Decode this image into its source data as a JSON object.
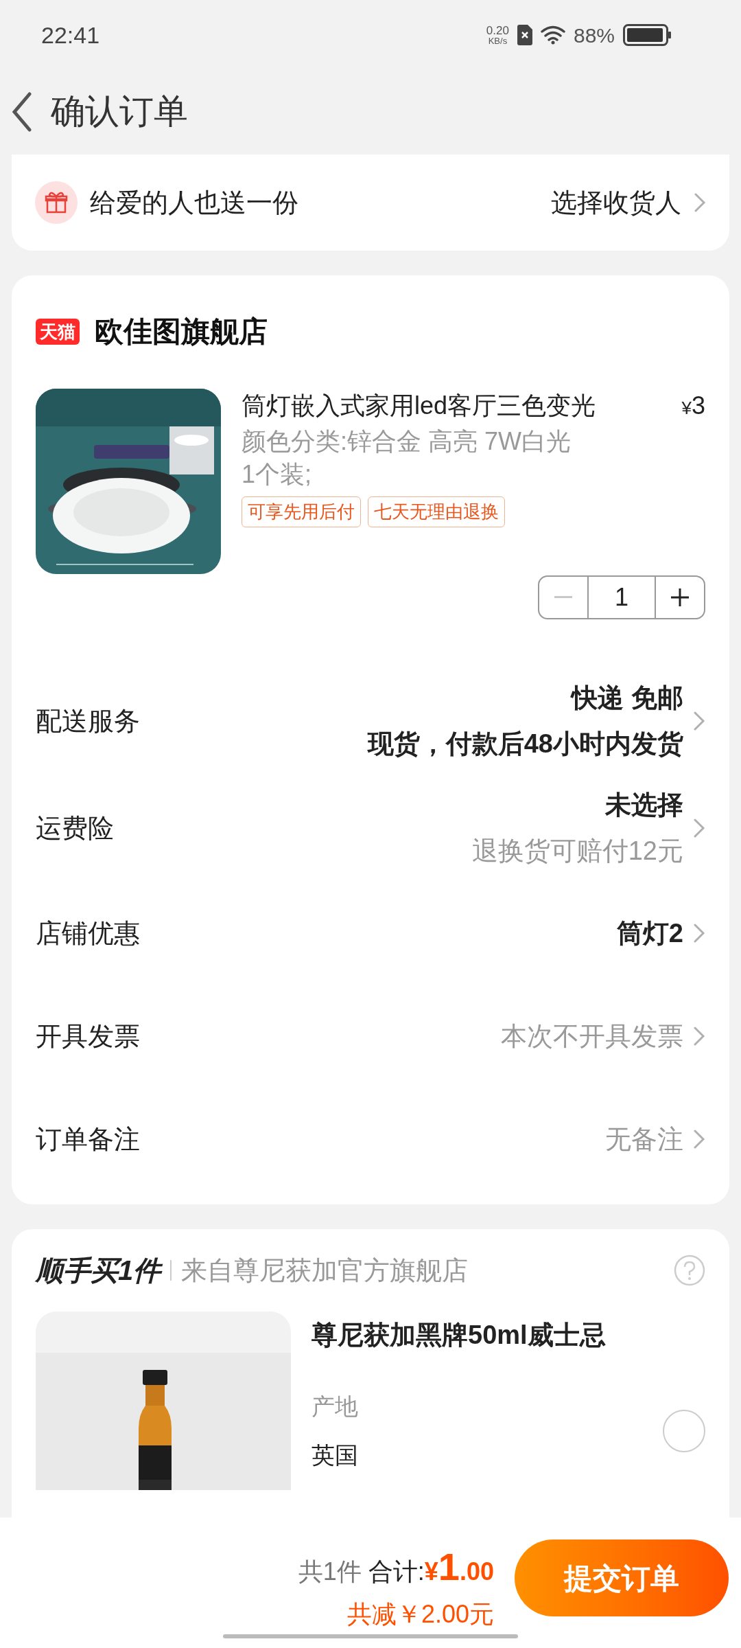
{
  "status_bar": {
    "time": "22:41",
    "net_speed_value": "0.20",
    "net_speed_unit": "KB/s",
    "battery": "88%"
  },
  "header": {
    "title": "确认订单"
  },
  "gift_row": {
    "label": "给爱的人也送一份",
    "action": "选择收货人"
  },
  "store": {
    "badge": "天猫",
    "name": "欧佳图旗舰店"
  },
  "product": {
    "title": "筒灯嵌入式家用led客厅三色变光",
    "currency": "¥",
    "price": "3",
    "specs": [
      "颜色分类:锌合金 高亮 7W白光",
      "1个装;"
    ],
    "tags": [
      "可享先用后付",
      "七天无理由退换"
    ],
    "quantity": "1",
    "minus_disabled": true
  },
  "rows": [
    {
      "label": "配送服务",
      "values": [
        {
          "text": "快递 免邮",
          "kind": "strong"
        },
        {
          "text": "现货，付款后48小时内发货",
          "kind": "strong"
        }
      ]
    },
    {
      "label": "运费险",
      "values": [
        {
          "text": "未选择",
          "kind": "strong"
        },
        {
          "text": "退换货可赔付12元",
          "kind": "muted"
        }
      ]
    },
    {
      "label": "店铺优惠",
      "values": [
        {
          "text": "筒灯2",
          "kind": "strong"
        }
      ]
    },
    {
      "label": "开具发票",
      "values": [
        {
          "text": "本次不开具发票",
          "kind": "muted"
        }
      ]
    },
    {
      "label": "订单备注",
      "values": [
        {
          "text": "无备注",
          "kind": "muted"
        }
      ]
    }
  ],
  "addon": {
    "title": "顺手买1件",
    "source": "来自尊尼获加官方旗舰店",
    "product_name": "尊尼获加黑牌50ml威士忌",
    "attr_label": "产地",
    "attr_value": "英国",
    "selected": false
  },
  "footer": {
    "count": "共1件",
    "total_label": "合计:",
    "currency": "¥",
    "integer": "1",
    "decimal": ".00",
    "discount": "共减￥2.00元",
    "submit": "提交订单"
  }
}
